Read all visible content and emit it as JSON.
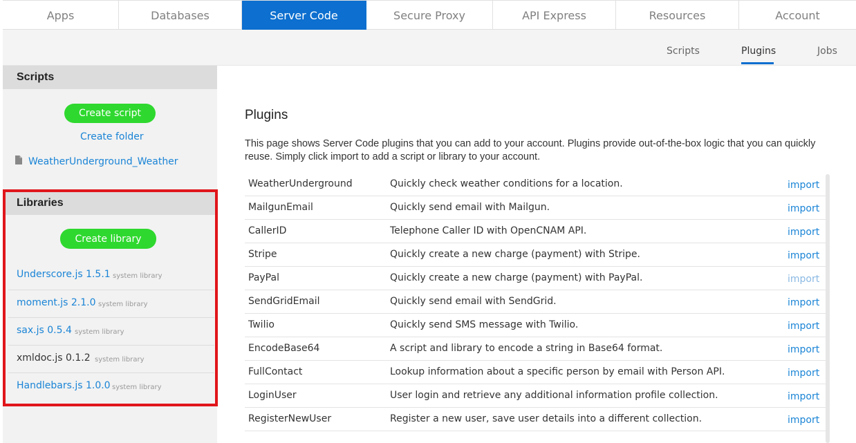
{
  "topnav": {
    "tabs": [
      {
        "label": "Apps",
        "active": false
      },
      {
        "label": "Databases",
        "active": false
      },
      {
        "label": "Server Code",
        "active": true
      },
      {
        "label": "Secure Proxy",
        "active": false
      },
      {
        "label": "API Express",
        "active": false
      },
      {
        "label": "Resources",
        "active": false
      },
      {
        "label": "Account",
        "active": false
      }
    ]
  },
  "subnav": {
    "tabs": [
      {
        "label": "Scripts",
        "active": false
      },
      {
        "label": "Plugins",
        "active": true
      },
      {
        "label": "Jobs",
        "active": false
      }
    ]
  },
  "sidebar": {
    "scripts_heading": "Scripts",
    "create_script_label": "Create script",
    "create_folder_label": "Create folder",
    "script_file": "WeatherUnderground_Weather",
    "libraries_heading": "Libraries",
    "create_library_label": "Create library",
    "libraries": [
      {
        "name": "Underscore.js 1.5.1",
        "tag": "system library",
        "link": true
      },
      {
        "name": "moment.js 2.1.0",
        "tag": "system library",
        "link": true
      },
      {
        "name": "sax.js 0.5.4",
        "tag": "system library",
        "link": true
      },
      {
        "name": "xmldoc.js 0.1.2",
        "tag": "system library",
        "link": false
      },
      {
        "name": "Handlebars.js 1.0.0",
        "tag": "system library",
        "link": true
      }
    ]
  },
  "main": {
    "title": "Plugins",
    "description": "This page shows Server Code plugins that you can add to your account. Plugins provide out-of-the-box logic that you can quickly reuse. Simply click import to add a script or library to your account.",
    "plugins": [
      {
        "name": "WeatherUnderground",
        "description": "Quickly check weather conditions for a location.",
        "action": "import"
      },
      {
        "name": "MailgunEmail",
        "description": "Quickly send email with Mailgun.",
        "action": "import"
      },
      {
        "name": "CallerID",
        "description": "Telephone Caller ID with OpenCNAM API.",
        "action": "import"
      },
      {
        "name": "Stripe",
        "description": "Quickly create a new charge (payment) with Stripe.",
        "action": "import"
      },
      {
        "name": "PayPal",
        "description": "Quickly create a new charge (payment) with PayPal.",
        "action": "import"
      },
      {
        "name": "SendGridEmail",
        "description": "Quickly send email with SendGrid.",
        "action": "import"
      },
      {
        "name": "Twilio",
        "description": "Quickly send SMS message with Twilio.",
        "action": "import"
      },
      {
        "name": "EncodeBase64",
        "description": "A script and library to encode a string in Base64 format.",
        "action": "import"
      },
      {
        "name": "FullContact",
        "description": "Lookup information about a specific person by email with Person API.",
        "action": "import"
      },
      {
        "name": "LoginUser",
        "description": "User login and retrieve any additional information profile collection.",
        "action": "import"
      },
      {
        "name": "RegisterNewUser",
        "description": "Register a new user, save user details into a different collection.",
        "action": "import"
      }
    ]
  },
  "colors": {
    "accent": "#0d6fcf",
    "success": "#2fd82f",
    "link": "#1a84d6",
    "highlight": "#e0161b"
  }
}
